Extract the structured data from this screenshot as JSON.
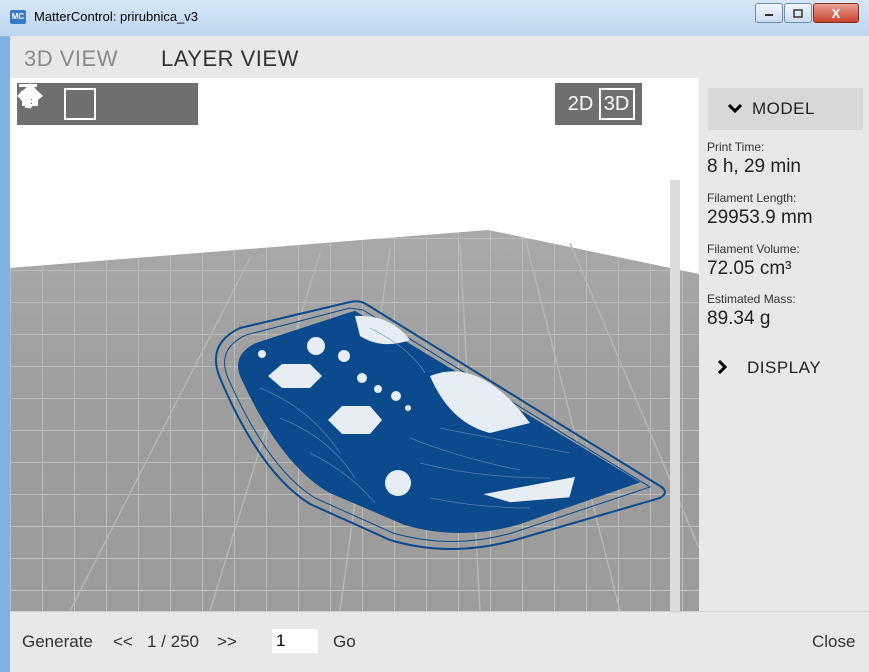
{
  "window": {
    "app_icon": "MC",
    "title": "MatterControl: prirubnica_v3",
    "minimize_icon": "minimize-icon",
    "maximize_icon": "maximize-icon",
    "close_icon": "close-icon",
    "close_glyph": "X"
  },
  "tabs": [
    {
      "label": "3D VIEW"
    },
    {
      "label": "LAYER VIEW"
    }
  ],
  "toolbar": {
    "icons": [
      "home-icon",
      "rotate-icon",
      "move-icon",
      "zoom-icon"
    ],
    "active": "rotate-icon",
    "view_2d": "2D",
    "view_3d": "3D"
  },
  "sidebar": {
    "model_label": "MODEL",
    "stats": [
      {
        "label": "Print Time:",
        "value": "8 h, 29 min"
      },
      {
        "label": "Filament Length:",
        "value": "29953.9 mm"
      },
      {
        "label": "Filament Volume:",
        "value": "72.05 cm³"
      },
      {
        "label": "Estimated Mass:",
        "value": "89.34 g"
      }
    ],
    "display_label": "DISPLAY"
  },
  "bottombar": {
    "generate": "Generate",
    "prev": "<<",
    "layer_counter": "1 / 250",
    "next": ">>",
    "layer_input": "1",
    "go": "Go",
    "close": "Close"
  },
  "colors": {
    "part": "#0b4a8c",
    "bed": "#9a9a9a",
    "slider_handle": "#1d4f86"
  }
}
